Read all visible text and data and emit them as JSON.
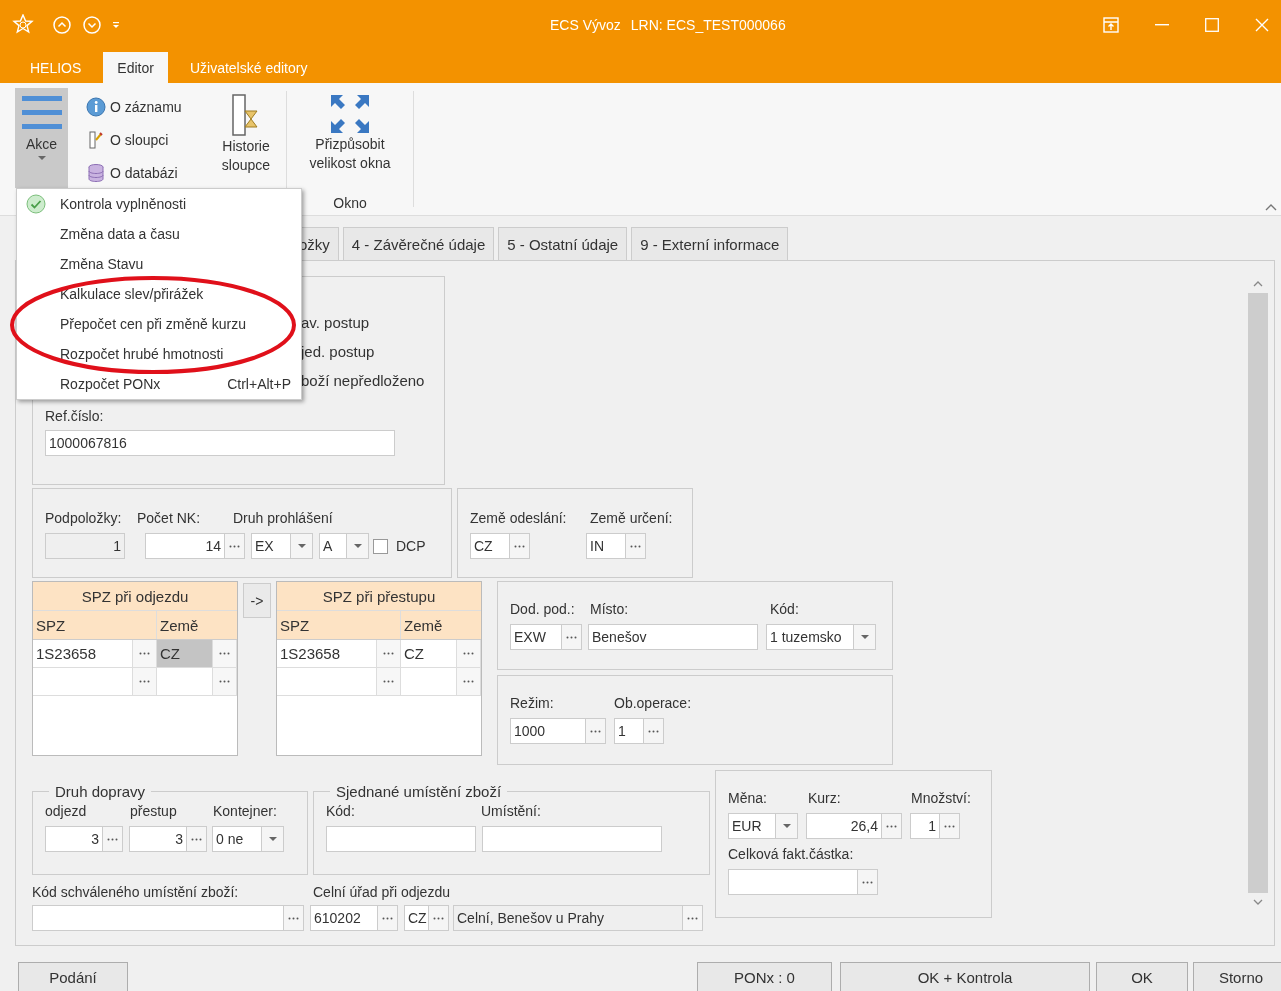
{
  "window": {
    "title": "ECS Vývoz",
    "subtitle": "LRN: ECS_TEST000066"
  },
  "ribbon_tabs": [
    {
      "label": "HELIOS",
      "selected": false
    },
    {
      "label": "Editor",
      "selected": true
    },
    {
      "label": "Uživatelské editory",
      "selected": false
    }
  ],
  "ribbon": {
    "akce": {
      "label": "Akce",
      "pressed": true
    },
    "small_buttons": [
      {
        "label": "O záznamu",
        "kind": "info"
      },
      {
        "label": "O sloupci",
        "kind": "column"
      },
      {
        "label": "O databázi",
        "kind": "database"
      }
    ],
    "history": "Historie sloupce",
    "resize": "Přizpůsobit velikost okna",
    "group_label": "Okno"
  },
  "action_menu": [
    {
      "label": "Kontrola vyplněnosti",
      "kind": "status"
    },
    {
      "label": "Změna data a času",
      "kind": "plain"
    },
    {
      "label": "Změna Stavu",
      "kind": "plain"
    },
    {
      "label": "Kalkulace slev/přirážek",
      "kind": "plain"
    },
    {
      "label": "Přepočet cen při změně kurzu",
      "kind": "plain"
    },
    {
      "label": "Rozpočet hrubé hmotnosti",
      "kind": "plain"
    },
    {
      "label": "Rozpočet PONx",
      "kind": "plain",
      "shortcut": "Ctrl+Alt+P"
    }
  ],
  "form_tabs": [
    {
      "label": "ožky",
      "selected": false
    },
    {
      "label": "4 - Závěrečné údaje",
      "selected": false
    },
    {
      "label": "5 - Ostatní údaje",
      "selected": false
    },
    {
      "label": "9 - Externí informace",
      "selected": false
    }
  ],
  "partially_hidden_options": [
    "av. postup",
    "jed. postup",
    "boží nepředloženo"
  ],
  "ref": {
    "label": "Ref.číslo:",
    "value": "1000067816"
  },
  "items": {
    "labels": [
      "Podpoložky:",
      "Počet NK:",
      "Druh prohlášení"
    ],
    "podpolozky": {
      "value": "1",
      "read_only": true
    },
    "pocet_nk": "14",
    "druh_1": "EX",
    "druh_2": "A",
    "dcp": {
      "label": "DCP",
      "checked": false
    }
  },
  "countries": {
    "labels": [
      "Země odeslání:",
      "Země určení:"
    ],
    "odeslani": "CZ",
    "urceni": "IN"
  },
  "plates": [
    {
      "title": "SPZ při odjezdu",
      "columns": [
        "SPZ",
        "Země"
      ],
      "rows": [
        {
          "cells": [
            {
              "text": "1S23658",
              "selected": false
            },
            {
              "text": "CZ",
              "selected": true
            }
          ]
        }
      ]
    },
    {
      "title": "SPZ při přestupu",
      "columns": [
        "SPZ",
        "Země"
      ],
      "rows": [
        {
          "cells": [
            {
              "text": "1S23658",
              "selected": false
            },
            {
              "text": "CZ",
              "selected": false
            }
          ]
        }
      ]
    }
  ],
  "copy_button": "->",
  "delivery": {
    "labels": [
      "Dod. pod.:",
      "Místo:",
      "Kód:"
    ],
    "terms": "EXW",
    "place": "Benešov",
    "code": "1 tuzemsko"
  },
  "regime": {
    "labels": [
      "Režim:",
      "Ob.operace:"
    ],
    "rezim": "1000",
    "operace": "1"
  },
  "transport": {
    "legend": "Druh dopravy",
    "labels": [
      "odjezd",
      "přestup",
      "Kontejner:"
    ],
    "odjezd": "3",
    "prestup": "3",
    "kontejner": "0 ne"
  },
  "location": {
    "legend": "Sjednané umístění zboží",
    "labels": [
      "Kód:",
      "Umístění:"
    ]
  },
  "approved_location": {
    "label": "Kód schváleného umístění zboží:"
  },
  "customs_office": {
    "label": "Celní úřad při odjezdu",
    "code": "610202",
    "country": "CZ",
    "name": {
      "value": "Celní, Benešov u Prahy",
      "read_only": true
    }
  },
  "currency": {
    "labels": [
      "Měna:",
      "Kurz:",
      "Množství:"
    ],
    "mena": "EUR",
    "kurz": "26,4",
    "mnozstvi": "1",
    "total_label": "Celková fakt.částka:"
  },
  "buttons": [
    "Podání",
    "PONx : 0",
    "OK + Kontrola",
    "OK",
    "Storno"
  ]
}
